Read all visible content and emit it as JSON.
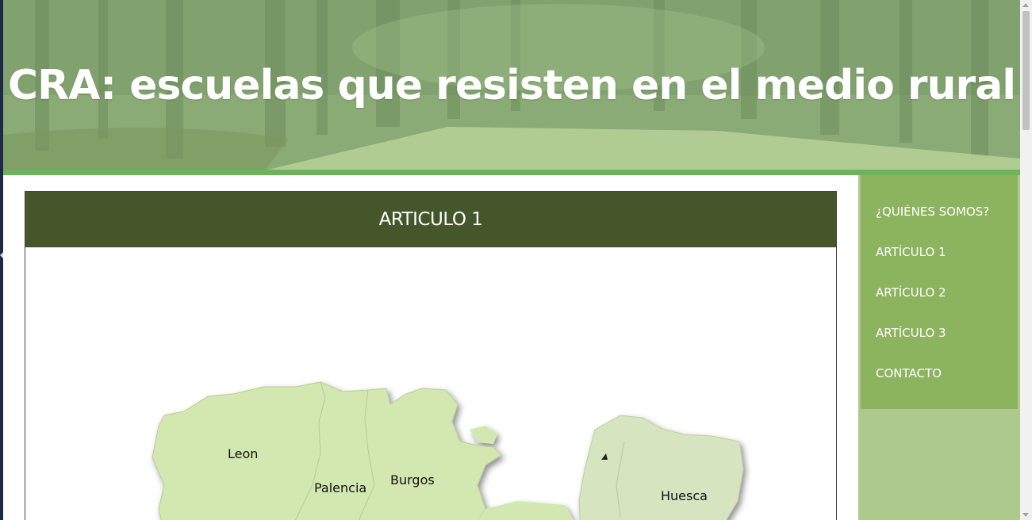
{
  "header": {
    "title": "CRA: escuelas que resisten en el medio rural"
  },
  "article": {
    "heading": "ARTICULO 1",
    "map": {
      "regions": [
        {
          "label": "Leon",
          "color": "#d3e8b0"
        },
        {
          "label": "Palencia",
          "color": "#d3e8b0"
        },
        {
          "label": "Burgos",
          "color": "#d3e8b0"
        },
        {
          "label": "Huesca",
          "color": "#d6e4bf"
        }
      ]
    }
  },
  "sidebar": {
    "items": [
      {
        "label": "¿QUIÉNES SOMOS?"
      },
      {
        "label": "ARTÍCULO 1"
      },
      {
        "label": "ARTÍCULO 2"
      },
      {
        "label": "ARTÍCULO 3"
      },
      {
        "label": "CONTACTO"
      }
    ]
  },
  "colors": {
    "article_header": "#44562a",
    "menu_bg": "#8cb35e",
    "sidebar_bg": "#adc98b",
    "header_rule": "#6db35c"
  }
}
